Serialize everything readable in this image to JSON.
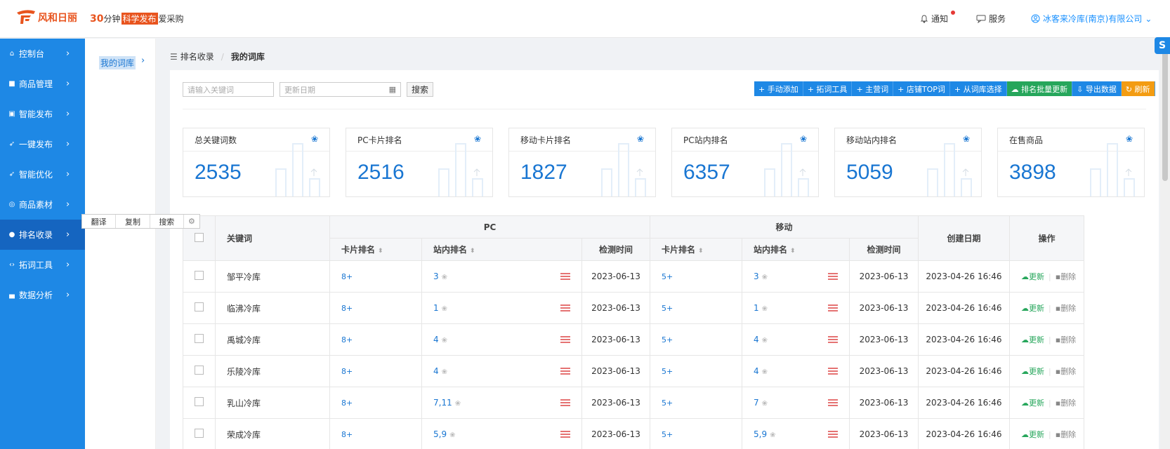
{
  "header": {
    "brand_name": "风和日丽",
    "slogan_num": "30",
    "slogan_mid": "分钟",
    "slogan_highlight": "科学发布",
    "slogan_end": "爱采购",
    "notify_label": "通知",
    "service_label": "服务",
    "company_name": "冰客来冷库(南京)有限公司"
  },
  "sidebar": {
    "items": [
      {
        "label": "控制台",
        "icon": "home-icon"
      },
      {
        "label": "商品管理",
        "icon": "box-icon"
      },
      {
        "label": "智能发布",
        "icon": "publish-icon"
      },
      {
        "label": "一键发布",
        "icon": "rocket-icon"
      },
      {
        "label": "智能优化",
        "icon": "optimize-icon"
      },
      {
        "label": "商品素材",
        "icon": "material-icon"
      },
      {
        "label": "排名收录",
        "icon": "rank-icon",
        "active": true
      },
      {
        "label": "拓词工具",
        "icon": "code-icon"
      },
      {
        "label": "数据分析",
        "icon": "chart-icon"
      }
    ]
  },
  "subpanel": {
    "item": "我的词库"
  },
  "context_menu": {
    "translate": "翻译",
    "copy": "复制",
    "search": "搜索"
  },
  "breadcrumb": {
    "parent": "排名收录",
    "current": "我的词库"
  },
  "filters": {
    "keyword_placeholder": "请输入关键词",
    "date_placeholder": "更新日期",
    "search_label": "搜索"
  },
  "toolbar": [
    {
      "label": "+ 手动添加",
      "color": "blue"
    },
    {
      "label": "+ 拓词工具",
      "color": "blue"
    },
    {
      "label": "+ 主营词",
      "color": "blue"
    },
    {
      "label": "+ 店铺TOP词",
      "color": "blue"
    },
    {
      "label": "+ 从词库选择",
      "color": "blue"
    },
    {
      "label": "☁ 排名批量更新",
      "color": "green"
    },
    {
      "label": "⇩ 导出数据",
      "color": "blue"
    },
    {
      "label": "↻ 刷新",
      "color": "orange"
    }
  ],
  "stats": [
    {
      "label": "总关键词数",
      "value": "2535"
    },
    {
      "label": "PC卡片排名",
      "value": "2516"
    },
    {
      "label": "移动卡片排名",
      "value": "1827"
    },
    {
      "label": "PC站内排名",
      "value": "6357"
    },
    {
      "label": "移动站内排名",
      "value": "5059"
    },
    {
      "label": "在售商品",
      "value": "3898"
    }
  ],
  "table": {
    "headers": {
      "keyword": "关键词",
      "pc": "PC",
      "mobile": "移动",
      "created": "创建日期",
      "actions": "操作",
      "card_rank": "卡片排名",
      "inner_rank": "站内排名",
      "check_time": "检测时间"
    },
    "update_label": "更新",
    "delete_label": "删除",
    "rows": [
      {
        "keyword": "邹平冷库",
        "pc_card": "8+",
        "pc_inner": "3",
        "pc_time": "2023-06-13",
        "m_card": "5+",
        "m_inner": "3",
        "m_time": "2023-06-13",
        "created": "2023-04-26 16:46"
      },
      {
        "keyword": "临沸冷库",
        "pc_card": "8+",
        "pc_inner": "1",
        "pc_time": "2023-06-13",
        "m_card": "5+",
        "m_inner": "1",
        "m_time": "2023-06-13",
        "created": "2023-04-26 16:46"
      },
      {
        "keyword": "禹城冷库",
        "pc_card": "8+",
        "pc_inner": "4",
        "pc_time": "2023-06-13",
        "m_card": "5+",
        "m_inner": "4",
        "m_time": "2023-06-13",
        "created": "2023-04-26 16:46"
      },
      {
        "keyword": "乐陵冷库",
        "pc_card": "8+",
        "pc_inner": "4",
        "pc_time": "2023-06-13",
        "m_card": "5+",
        "m_inner": "4",
        "m_time": "2023-06-13",
        "created": "2023-04-26 16:46"
      },
      {
        "keyword": "乳山冷库",
        "pc_card": "8+",
        "pc_inner": "7,11",
        "pc_time": "2023-06-13",
        "m_card": "5+",
        "m_inner": "7",
        "m_time": "2023-06-13",
        "created": "2023-04-26 16:46"
      },
      {
        "keyword": "荣成冷库",
        "pc_card": "8+",
        "pc_inner": "5,9",
        "pc_time": "2023-06-13",
        "m_card": "5+",
        "m_inner": "5,9",
        "m_time": "2023-06-13",
        "created": "2023-04-26 16:46"
      }
    ]
  },
  "colors": {
    "brand": "#e8541e",
    "sidebar": "#1e88e5",
    "sidebar_active": "#1565c0",
    "accent": "#1976d2",
    "update_green": "#26a65b",
    "refresh_orange": "#f39c12"
  }
}
